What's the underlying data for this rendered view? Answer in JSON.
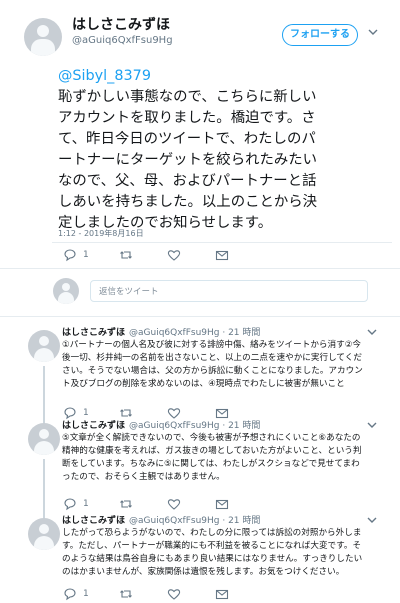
{
  "main_tweet": {
    "display_name": "はしさこみずほ",
    "handle": "@aGuiq6QxfFsu9Hg",
    "follow_label": "フォローする",
    "mention": "@Sibyl_8379",
    "text_lines": [
      "恥ずかしい事態なので、こちらに新しい",
      "アカウントを取りました。橋迫です。さ",
      "て、昨日今日のツイートで、わたしのパ",
      "ートナーにターゲットを絞られたみたい",
      "なので、父、母、およびパートナーと話",
      "しあいを持ちました。以上のことから決",
      "定しましたのでお知らせします。"
    ],
    "timestamp": "1:12 - 2019年8月16日",
    "reply_count": "1"
  },
  "reply_box": {
    "placeholder": "返信をツイート"
  },
  "replies": [
    {
      "name": "はしさこみずほ",
      "handle_time": "@aGuiq6QxfFsu9Hg · 21 時間",
      "lines": [
        "①パートナーの個人名及び彼に対する誹謗中傷、絡みをツイートから消す②今",
        "後一切、杉井純一の名前を出さないこと、以上の二点を速やかに実行してくだ",
        "さい。そうでない場合は、父の方から訴訟に動くことになりました。アカウン",
        "ト及びブログの削除を求めないのは、④現時点でわたしに被害が無いこと"
      ],
      "reply_count": "1"
    },
    {
      "name": "はしさこみずほ",
      "handle_time": "@aGuiq6QxfFsu9Hg · 21 時間",
      "lines": [
        "⑤文章が全く解読できないので、今後も被害が予想されにくいこと⑥あなたの",
        "精神的な健康を考えれば、ガス抜きの場としておいた方がよいこと、という判",
        "断をしています。ちなみに⑤に関しては、わたしがスクショなどで見せてまわ",
        "ったので、おそらく主観ではありません。"
      ],
      "reply_count": "1"
    },
    {
      "name": "はしさこみずほ",
      "handle_time": "@aGuiq6QxfFsu9Hg · 21 時間",
      "lines": [
        "したがって恐らようがないので、わたしの分に限っては訴訟の対照から外しま",
        "す。ただし、パートナーが職業的にも不利益を被ることになれば大変です。そ",
        "のような結果は鳥谷自身にもあまり良い結果にはなりません。すっきりしたい",
        "のはかまいませんが、家族関係は遺恨を残します。お気をつけください。"
      ],
      "reply_count": "1"
    }
  ],
  "colors": {
    "accent": "#1da1f2",
    "muted": "#657786",
    "border": "#e6ecf0"
  },
  "icons": [
    "caret-down-icon",
    "reply-icon",
    "retweet-icon",
    "like-icon",
    "dm-icon"
  ]
}
